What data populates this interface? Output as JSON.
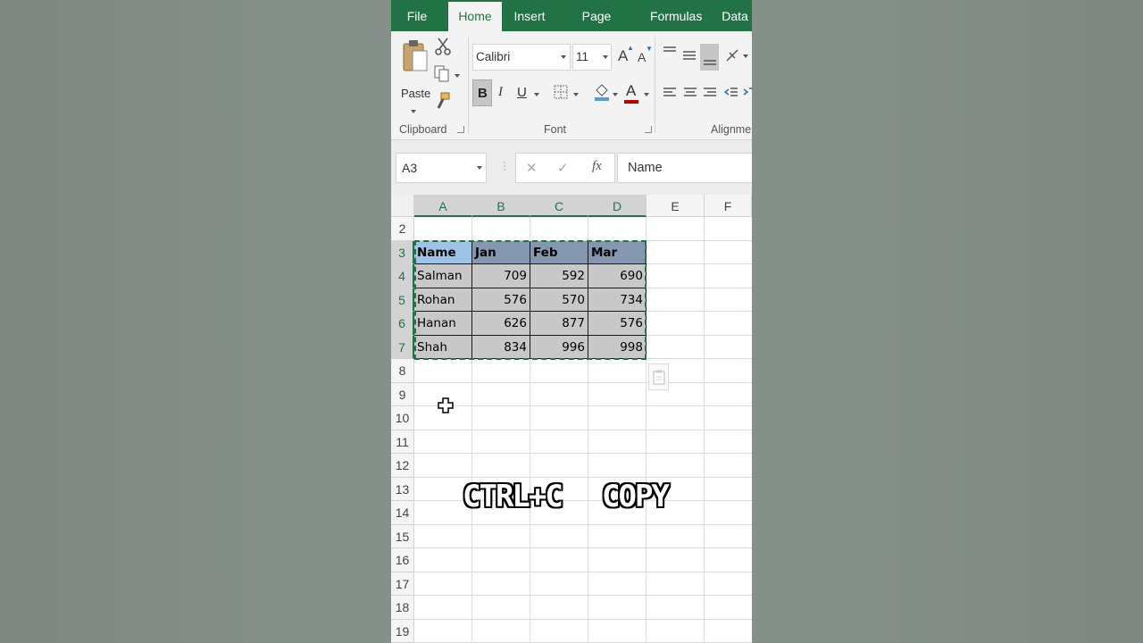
{
  "ribbon": {
    "tabs": [
      {
        "label": "File"
      },
      {
        "label": "Home",
        "active": true
      },
      {
        "label": "Insert"
      },
      {
        "label": "Page Layout"
      },
      {
        "label": "Formulas"
      },
      {
        "label": "Data"
      }
    ],
    "clipboard": {
      "paste_label": "Paste",
      "group_label": "Clipboard"
    },
    "font": {
      "font_name": "Calibri",
      "font_size": "11",
      "group_label": "Font",
      "bold": "B",
      "italic": "I",
      "underline": "U",
      "grow": "A",
      "shrink": "A",
      "font_color": "A"
    },
    "alignment": {
      "group_label": "Alignmen"
    }
  },
  "formula_bar": {
    "name_box": "A3",
    "cancel": "✕",
    "enter": "✓",
    "fx": "fx",
    "value": "Name"
  },
  "grid": {
    "columns": [
      "A",
      "B",
      "C",
      "D",
      "E",
      "F"
    ],
    "selected_columns": [
      "A",
      "B",
      "C",
      "D"
    ],
    "rows": [
      "2",
      "3",
      "4",
      "5",
      "6",
      "7",
      "8",
      "9",
      "10",
      "11",
      "12",
      "13",
      "14",
      "15",
      "16",
      "17",
      "18",
      "19"
    ],
    "selected_rows": [
      "3",
      "4",
      "5",
      "6",
      "7"
    ],
    "header_row": [
      "Name",
      "Jan",
      "Feb",
      "Mar"
    ],
    "data_rows": [
      [
        "Salman",
        "709",
        "592",
        "690"
      ],
      [
        "Rohan",
        "576",
        "570",
        "734"
      ],
      [
        "Hanan",
        "626",
        "877",
        "576"
      ],
      [
        "Shah",
        "834",
        "996",
        "998"
      ]
    ],
    "active_cell": "A3",
    "copy_range": "A3:D7"
  },
  "overlay": {
    "shortcut": "CTRL+C",
    "action": "COPY"
  },
  "colors": {
    "accent": "#217346",
    "header_fill": "#8496b0",
    "name_header_fill": "#9dc3e6",
    "body_fill": "#c8c8c8",
    "font_red": "#c00000"
  }
}
